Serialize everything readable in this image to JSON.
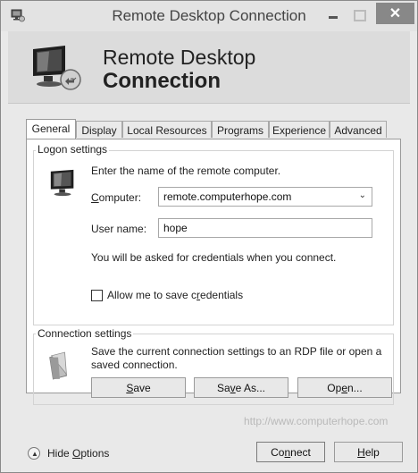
{
  "window": {
    "title": "Remote Desktop Connection",
    "close_glyph": "✕"
  },
  "banner": {
    "line1": "Remote Desktop",
    "line2": "Connection"
  },
  "tabs": [
    {
      "label": "General",
      "active": true
    },
    {
      "label": "Display"
    },
    {
      "label": "Local Resources"
    },
    {
      "label": "Programs"
    },
    {
      "label": "Experience"
    },
    {
      "label": "Advanced"
    }
  ],
  "logon": {
    "group_label": "Logon settings",
    "instruction": "Enter the name of the remote computer.",
    "computer_label": "Computer:",
    "computer_value": "remote.computerhope.com",
    "username_label": "User name:",
    "username_value": "hope",
    "credentials_note": "You will be asked for credentials when you connect.",
    "save_credentials_label": "Allow me to save credentials",
    "save_credentials_checked": false
  },
  "connection": {
    "group_label": "Connection settings",
    "description_line1": "Save the current connection settings to an RDP file or open a",
    "description_line2": "saved connection.",
    "save_label": "Save",
    "save_as_label": "Save As...",
    "open_label": "Open..."
  },
  "watermark": "http://www.computerhope.com",
  "footer": {
    "hide_options_label": "Hide Options",
    "connect_label": "Connect",
    "help_label": "Help"
  },
  "icons": {
    "app": "remote-desktop-icon",
    "banner": "monitor-connection-icon",
    "logon": "computer-monitor-icon",
    "connection": "document-folder-icon",
    "hide_options": "chevron-up-circle-icon"
  }
}
